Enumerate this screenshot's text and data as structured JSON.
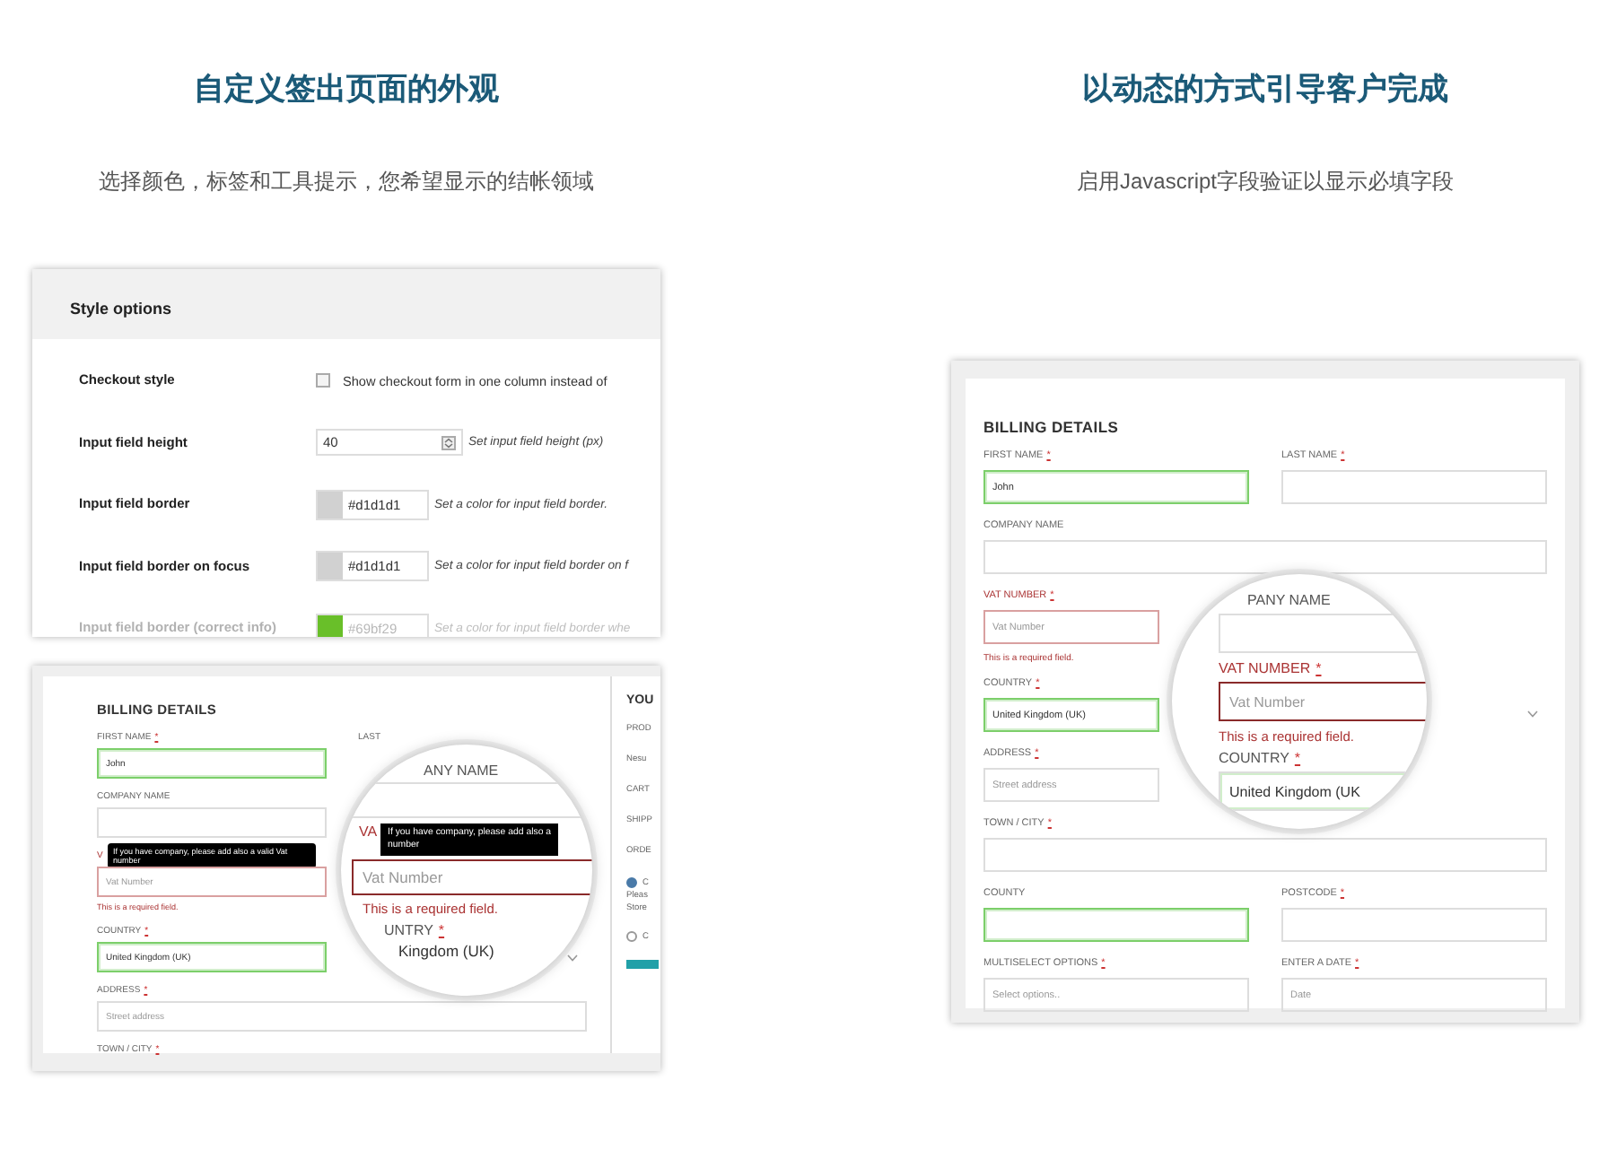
{
  "columns": [
    {
      "title": "自定义签出页面的外观",
      "subtitle": "选择颜色，标签和工具提示，您希望显示的结帐领域",
      "style_panel": {
        "title": "Style options",
        "rows": [
          {
            "kind": "checkbox",
            "label": "Checkout style",
            "checked": false,
            "text": "Show checkout form in one column instead of",
            "faded": false
          },
          {
            "kind": "number",
            "label": "Input field height",
            "value": "40",
            "hint": "Set input field height (px)",
            "faded": false
          },
          {
            "kind": "color",
            "label": "Input field border",
            "color": "#d1d1d1",
            "value": "#d1d1d1",
            "hint": "Set a color for input field border.",
            "faded": false
          },
          {
            "kind": "color",
            "label": "Input field border on focus",
            "color": "#d1d1d1",
            "value": "#d1d1d1",
            "hint": "Set a color for input field border on f",
            "faded": false
          },
          {
            "kind": "color",
            "label": "Input field border (correct info)",
            "color": "#69bf29",
            "value": "#69bf29",
            "hint": "Set a color for input field border whe",
            "faded": true
          }
        ]
      },
      "preview": {
        "title": "BILLING DETAILS",
        "rows": [
          [
            {
              "label": "FIRST NAME",
              "mark": "*",
              "valid": true,
              "invalid": false,
              "value": "John"
            },
            {
              "label": "LAST",
              "kind": "label-only"
            }
          ],
          [
            {
              "label": "COMPANY NAME",
              "valid": false,
              "invalid": false
            }
          ],
          [
            {
              "label": "V",
              "valid": false,
              "invalid": true,
              "placeholder": "Vat Number",
              "error": "This is a required field.",
              "tooltip": "If you have company, please add also a valid Vat number"
            }
          ],
          [
            {
              "label": "COUNTRY",
              "mark": "*",
              "valid": true,
              "invalid": false,
              "value": "United Kingdom (UK)",
              "kind": "select"
            }
          ],
          [
            {
              "label": "ADDRESS",
              "mark": "*",
              "valid": false,
              "invalid": false,
              "placeholder": "Street address"
            }
          ],
          [
            {
              "label": "TOWN / CITY",
              "mark": "*",
              "kind": "label-only"
            }
          ]
        ],
        "side": {
          "title": "YOU",
          "items": [
            "PROD",
            "Nesu",
            "CART",
            "SHIPP",
            "ORDE"
          ],
          "radios": [
            {
              "label": "C",
              "selected": true,
              "lines": [
                "Pleas",
                "Store"
              ]
            },
            {
              "label": "C",
              "selected": false
            }
          ]
        },
        "magnifier": [
          {
            "kind": "label",
            "text": "ANY NAME",
            "invalid": false
          },
          {
            "kind": "field",
            "valid": false,
            "invalid": false
          },
          {
            "kind": "label",
            "text": "VA",
            "invalid": true
          },
          {
            "kind": "tooltip",
            "lines": [
              "If you have company, please add also a",
              "number"
            ]
          },
          {
            "kind": "field",
            "valid": false,
            "invalid": true,
            "placeholder": "Vat Number"
          },
          {
            "kind": "error",
            "text": "This is a required field."
          },
          {
            "kind": "label",
            "text": "UNTRY",
            "mark": "*",
            "invalid": false
          },
          {
            "kind": "plain",
            "text": "Kingdom (UK)"
          }
        ]
      }
    },
    {
      "title": "以动态的方式引导客户完成",
      "subtitle": "启用Javascript字段验证以显示必填字段",
      "preview": {
        "title": "BILLING DETAILS",
        "rows": [
          [
            {
              "label": "FIRST NAME",
              "mark": "*",
              "valid": true,
              "invalid": false,
              "value": "John"
            },
            {
              "label": "LAST NAME",
              "mark": "*",
              "valid": false,
              "invalid": false
            }
          ],
          [
            {
              "label": "COMPANY NAME",
              "valid": false,
              "invalid": false
            }
          ],
          [
            {
              "label": "VAT NUMBER",
              "mark": "*",
              "valid": false,
              "invalid": true,
              "placeholder": "Vat Number",
              "error": "This is a required field."
            }
          ],
          [
            {
              "label": "COUNTRY",
              "mark": "*",
              "valid": true,
              "invalid": false,
              "value": "United Kingdom (UK)",
              "kind": "select"
            }
          ],
          [
            {
              "label": "ADDRESS",
              "mark": "*",
              "valid": false,
              "invalid": false,
              "placeholder": "Street address"
            }
          ],
          [
            {
              "label": "TOWN / CITY",
              "mark": "*",
              "valid": false,
              "invalid": false
            }
          ],
          [
            {
              "label": "COUNTY",
              "valid": true,
              "invalid": false
            },
            {
              "label": "POSTCODE",
              "mark": "*",
              "valid": false,
              "invalid": false
            }
          ],
          [
            {
              "label": "MULTISELECT OPTIONS",
              "mark": "*",
              "valid": false,
              "invalid": false,
              "placeholder": "Select options.."
            },
            {
              "label": "ENTER A DATE",
              "mark": "*",
              "valid": false,
              "invalid": false,
              "placeholder": "Date"
            }
          ]
        ],
        "magnifier": [
          {
            "kind": "label",
            "text": "PANY NAME",
            "invalid": false
          },
          {
            "kind": "field",
            "valid": false,
            "invalid": false
          },
          {
            "kind": "label",
            "text": "VAT NUMBER",
            "mark": "*",
            "invalid": true
          },
          {
            "kind": "field",
            "valid": false,
            "invalid": true,
            "placeholder": "Vat Number"
          },
          {
            "kind": "error",
            "text": "This is a required field."
          },
          {
            "kind": "label",
            "text": "COUNTRY",
            "mark": "*",
            "invalid": false
          },
          {
            "kind": "field",
            "valid": true,
            "invalid": false,
            "value": "United Kingdom (UK"
          }
        ]
      }
    }
  ]
}
